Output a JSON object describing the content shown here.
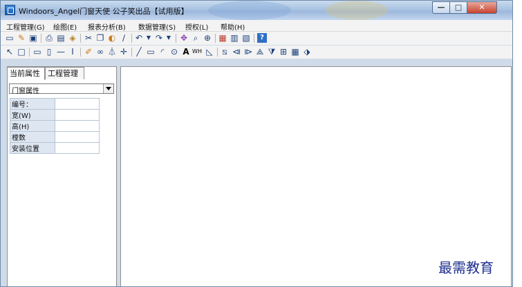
{
  "window": {
    "title": "Windoors_Angel门窗天使  公子笑出品【试用版】"
  },
  "window_controls": {
    "minimize": "—",
    "maximize": "□",
    "close": "✕"
  },
  "menu": [
    "工程管理(G)",
    "绘图(E)",
    "报表分析(B)",
    "数据管理(S)",
    "授权(L)",
    "帮助(H)"
  ],
  "toolbar1": [
    "new-doc-icon",
    "edit-icon",
    "save-icon",
    "print-preview-icon",
    "print-icon",
    "export-icon",
    "cut-icon",
    "copy-icon",
    "paste-icon",
    "brush-icon",
    "undo-icon",
    "redo-icon",
    "pan-icon",
    "zoom-window-icon",
    "zoom-icon",
    "calc-icon",
    "report-icon",
    "list-icon",
    "help-icon"
  ],
  "toolbar2": [
    "pointer-icon",
    "rect-select-icon",
    "h-bar-icon",
    "v-bar-icon",
    "h-line-tool-icon",
    "v-line-tool-icon",
    "pen-icon",
    "link-icon",
    "mirror-icon",
    "move-icon",
    "line-icon",
    "rect-icon",
    "arc-icon",
    "circle-icon",
    "text-icon",
    "dimension-icon",
    "angle-icon",
    "glass-icon",
    "left-tri-icon",
    "right-tri-icon",
    "up-tri-icon",
    "down-tri-icon",
    "cross-icon",
    "grid-icon",
    "diamond-icon"
  ],
  "tabs": [
    "当前属性",
    "工程管理"
  ],
  "combo": {
    "value": "门窗属性"
  },
  "properties": [
    {
      "label": "编号：",
      "value": ""
    },
    {
      "label": "宽(W)",
      "value": ""
    },
    {
      "label": "高(H)",
      "value": ""
    },
    {
      "label": "樘数",
      "value": ""
    },
    {
      "label": "安装位置",
      "value": ""
    }
  ],
  "watermark": "最需教育"
}
